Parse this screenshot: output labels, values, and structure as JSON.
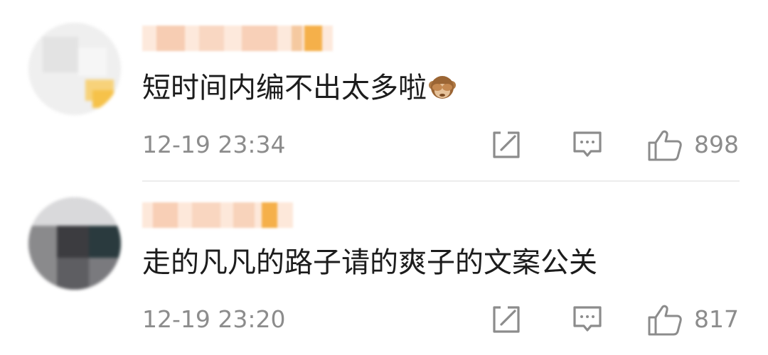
{
  "comments": [
    {
      "text": "短时间内编不出太多啦",
      "emoji": "see-no-evil-monkey",
      "time": "12-19 23:34",
      "likes": "898"
    },
    {
      "text": "走的凡凡的路子请的爽子的文案公关",
      "time": "12-19 23:20",
      "likes": "817"
    }
  ],
  "colors": {
    "text": "#1c1c1c",
    "meta": "#8c8c8c",
    "name_blur_light": "#fbe1cf",
    "name_blur_accent": "#f5b04a",
    "divider": "#ececec"
  },
  "icons": {
    "share": "share-icon",
    "reply": "comment-icon",
    "like": "thumbs-up-icon"
  }
}
